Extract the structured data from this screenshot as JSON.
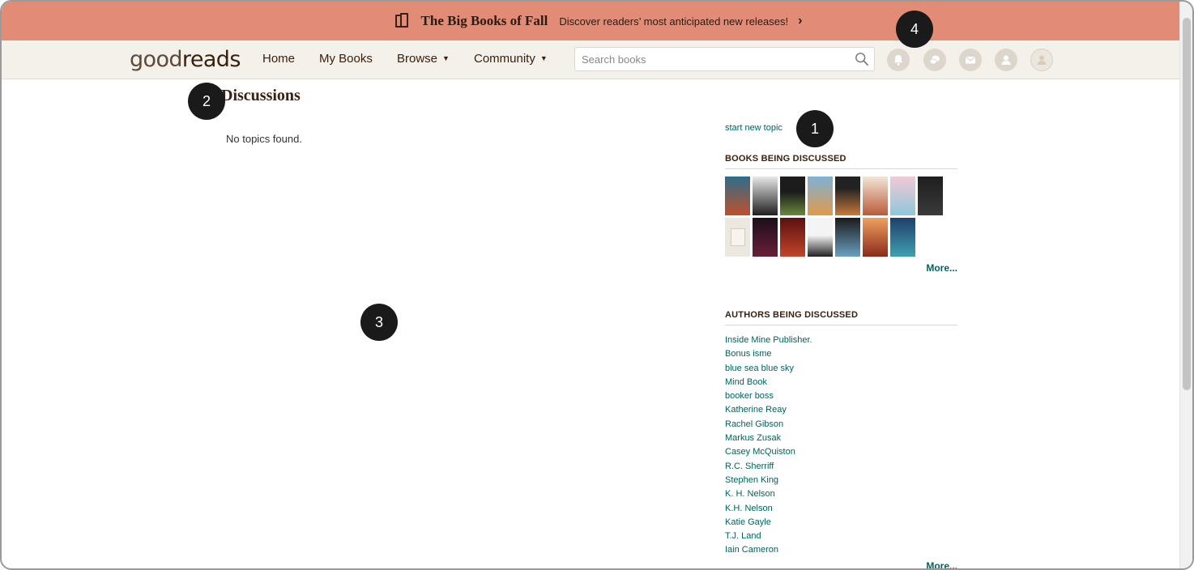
{
  "promo": {
    "title": "The Big Books of Fall",
    "subtitle": "Discover readers’ most anticipated new releases!",
    "chevron": "›"
  },
  "nav": {
    "logo_part1": "good",
    "logo_part2": "reads",
    "home": "Home",
    "my_books": "My Books",
    "browse": "Browse",
    "community": "Community",
    "caret": "▼",
    "search_placeholder": "Search books"
  },
  "main": {
    "title": "Discussions",
    "empty_message": "No topics found."
  },
  "sidebar": {
    "start_topic": "start new topic",
    "books_heading": "Books being discussed",
    "books_more": "More...",
    "authors_heading": "Authors being discussed",
    "authors_more": "More...",
    "authors": [
      "Inside Mine Publisher.",
      "Bonus isme",
      "blue sea blue sky",
      "Mind Book",
      "booker boss",
      "Katherine Reay",
      "Rachel Gibson",
      "Markus Zusak",
      "Casey McQuiston",
      "R.C. Sherriff",
      "Stephen King",
      "K. H. Nelson",
      "K.H. Nelson",
      "Katie Gayle",
      "T.J. Land",
      "Iain Cameron"
    ]
  },
  "markers": [
    "1",
    "2",
    "3",
    "4"
  ],
  "colors": {
    "banner": "#e28c78",
    "nav_bg": "#f4f1ea",
    "link": "#00635d",
    "brown": "#382110"
  }
}
